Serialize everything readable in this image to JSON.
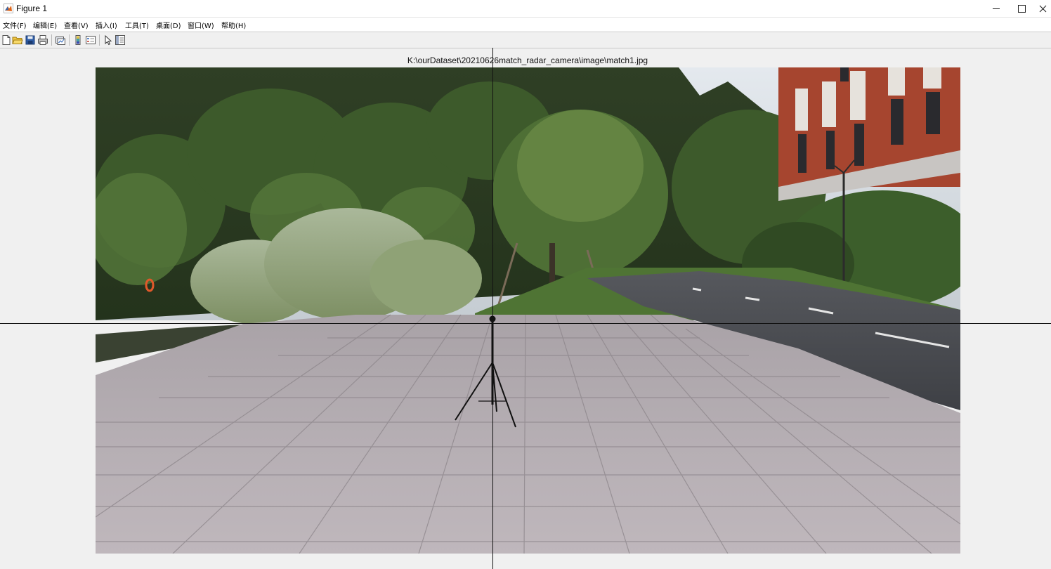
{
  "window": {
    "title": "Figure 1",
    "app_icon": "matlab-logo-icon",
    "controls": [
      "minimize-icon",
      "maximize-icon",
      "close-icon"
    ]
  },
  "menu": [
    {
      "label": "文件(F)"
    },
    {
      "label": "编辑(E)"
    },
    {
      "label": "查看(V)"
    },
    {
      "label": "插入(I)"
    },
    {
      "label": "工具(T)"
    },
    {
      "label": "桌面(D)"
    },
    {
      "label": "窗口(W)"
    },
    {
      "label": "帮助(H)"
    }
  ],
  "toolbar": [
    "new-figure-icon",
    "open-file-icon",
    "save-icon",
    "print-icon",
    "link-plot-icon",
    "insert-colorbar-icon",
    "insert-legend-icon",
    "edit-plot-icon",
    "property-inspector-icon"
  ],
  "axes": {
    "title": "K:\\ourDataset\\20210626match_radar_camera\\image\\match1.jpg"
  },
  "colors": {
    "figure_bg": "#f0f0f0",
    "crosshair": "#111111",
    "sky": "#d7dee4",
    "foliage_dark": "#2c3f22",
    "foliage_light": "#6f8a48",
    "building_brick": "#a4442f",
    "road": "#4b4d52",
    "pavement": "#b4acb0"
  }
}
